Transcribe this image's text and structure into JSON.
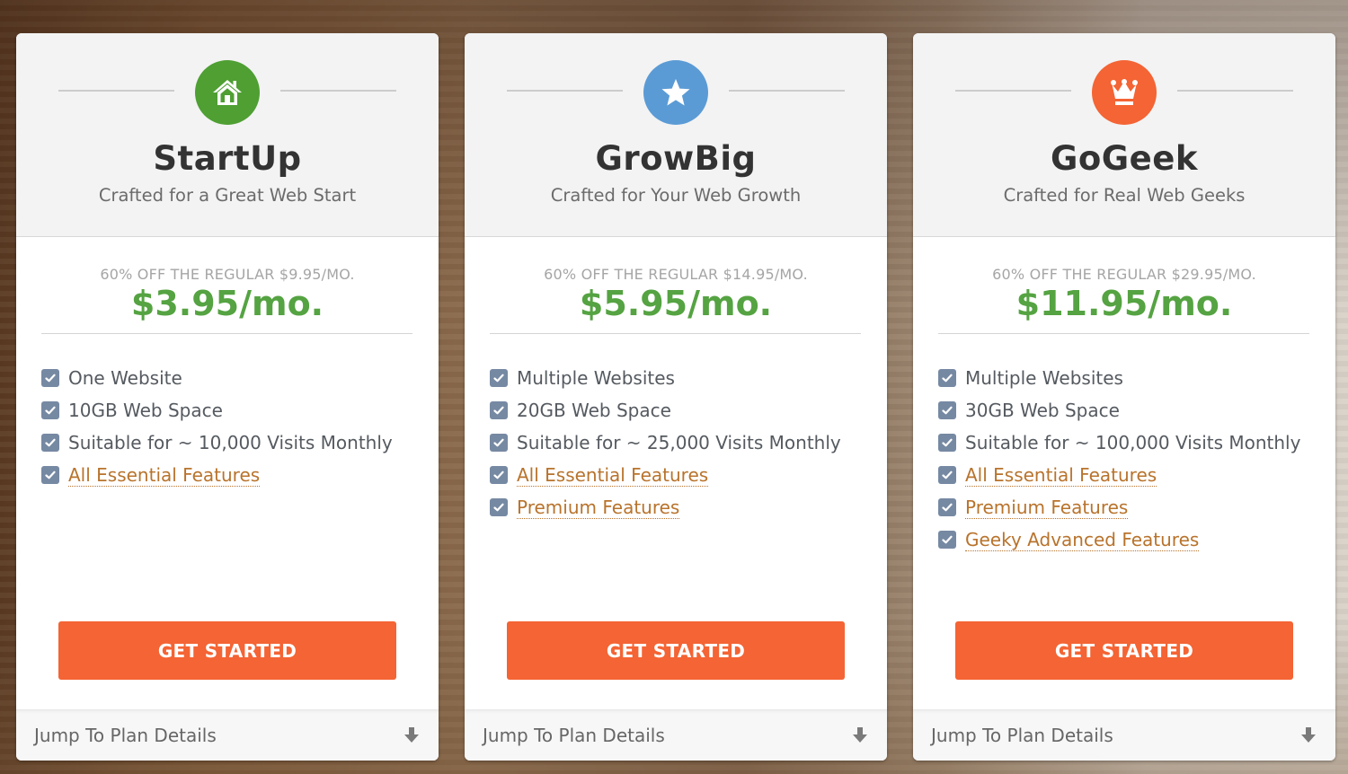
{
  "colors": {
    "accent_orange": "#f46434",
    "price_green": "#55a342",
    "link_brown": "#b8732c",
    "check_slate": "#7689a3"
  },
  "plans": [
    {
      "name": "StartUp",
      "tagline": "Crafted for a Great Web Start",
      "icon": "home-icon",
      "icon_color": "#4f9f33",
      "regular_note": "60% OFF THE REGULAR $9.95/MO.",
      "price": "$3.95/mo.",
      "features": [
        {
          "text": "One Website",
          "link": false
        },
        {
          "text": "10GB Web Space",
          "link": false
        },
        {
          "text": "Suitable for ~ 10,000 Visits Monthly",
          "link": false
        },
        {
          "text": "All Essential Features",
          "link": true
        }
      ],
      "cta_label": "GET STARTED",
      "jump_label": "Jump To Plan Details"
    },
    {
      "name": "GrowBig",
      "tagline": "Crafted for Your Web Growth",
      "icon": "star-icon",
      "icon_color": "#5b9bd5",
      "regular_note": "60% OFF THE REGULAR $14.95/MO.",
      "price": "$5.95/mo.",
      "features": [
        {
          "text": "Multiple Websites",
          "link": false
        },
        {
          "text": "20GB Web Space",
          "link": false
        },
        {
          "text": "Suitable for ~ 25,000 Visits Monthly",
          "link": false
        },
        {
          "text": "All Essential Features",
          "link": true
        },
        {
          "text": "Premium Features",
          "link": true
        }
      ],
      "cta_label": "GET STARTED",
      "jump_label": "Jump To Plan Details"
    },
    {
      "name": "GoGeek",
      "tagline": "Crafted for Real Web Geeks",
      "icon": "crown-icon",
      "icon_color": "#f46434",
      "regular_note": "60% OFF THE REGULAR $29.95/MO.",
      "price": "$11.95/mo.",
      "features": [
        {
          "text": "Multiple Websites",
          "link": false
        },
        {
          "text": "30GB Web Space",
          "link": false
        },
        {
          "text": "Suitable for ~ 100,000 Visits Monthly",
          "link": false
        },
        {
          "text": "All Essential Features",
          "link": true
        },
        {
          "text": "Premium Features",
          "link": true
        },
        {
          "text": "Geeky Advanced Features",
          "link": true
        }
      ],
      "cta_label": "GET STARTED",
      "jump_label": "Jump To Plan Details"
    }
  ]
}
